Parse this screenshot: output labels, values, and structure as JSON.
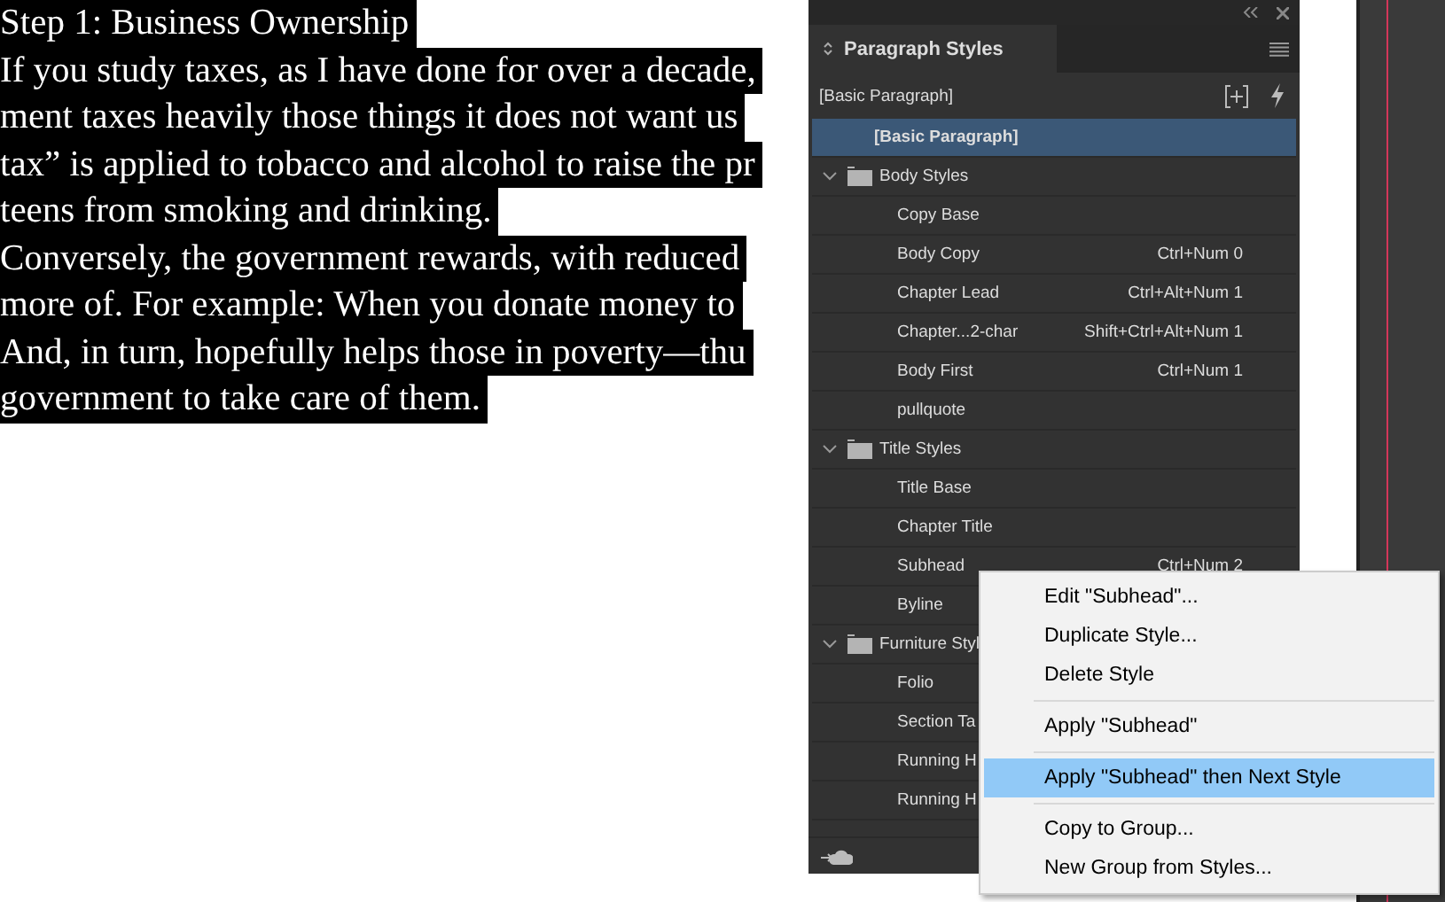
{
  "document": {
    "lines": [
      {
        "text": "Step 1: Business Ownership"
      },
      {
        "text": "If you study taxes, as I have done for over a decade,"
      },
      {
        "text": "ment taxes heavily those things it does not want us"
      },
      {
        "text": "tax” is applied to tobacco and alcohol to raise the pr"
      },
      {
        "text": "teens from smoking and drinking."
      },
      {
        "text": "Conversely, the government rewards, with reduced"
      },
      {
        "text": "more of. For example: When you donate money to"
      },
      {
        "text": "And, in turn, hopefully helps those in poverty—thu"
      },
      {
        "text": "government to take care of them."
      }
    ]
  },
  "panel": {
    "title": "Paragraph Styles",
    "current_style": "[Basic Paragraph]",
    "styles": [
      {
        "kind": "style",
        "name": "[Basic Paragraph]",
        "bold": true,
        "selected": true
      },
      {
        "kind": "group",
        "name": "Body Styles",
        "expanded": true,
        "selected": false,
        "children": [
          {
            "kind": "style",
            "name": "Copy Base",
            "selected": false
          },
          {
            "kind": "style",
            "name": "Body Copy",
            "shortcut": "Ctrl+Num 0",
            "selected": false
          },
          {
            "kind": "style",
            "name": "Chapter Lead",
            "shortcut": "Ctrl+Alt+Num 1",
            "selected": false
          },
          {
            "kind": "style",
            "name": "Chapter...2-char",
            "shortcut": "Shift+Ctrl+Alt+Num 1",
            "selected": false
          },
          {
            "kind": "style",
            "name": "Body First",
            "shortcut": "Ctrl+Num 1",
            "selected": false
          },
          {
            "kind": "style",
            "name": "pullquote",
            "selected": false
          }
        ]
      },
      {
        "kind": "group",
        "name": "Title Styles",
        "expanded": true,
        "selected": false,
        "children": [
          {
            "kind": "style",
            "name": "Title Base",
            "selected": false
          },
          {
            "kind": "style",
            "name": "Chapter Title",
            "selected": false
          },
          {
            "kind": "style",
            "name": "Subhead",
            "shortcut": "Ctrl+Num 2",
            "selected": false
          },
          {
            "kind": "style",
            "name": "Byline",
            "selected": false
          }
        ]
      },
      {
        "kind": "group",
        "name": "Furniture Styl",
        "expanded": true,
        "selected": false,
        "children": [
          {
            "kind": "style",
            "name": "Folio",
            "selected": false
          },
          {
            "kind": "style",
            "name": "Section Ta",
            "selected": false
          },
          {
            "kind": "style",
            "name": "Running H",
            "selected": false
          },
          {
            "kind": "style",
            "name": "Running H",
            "selected": false
          }
        ]
      }
    ]
  },
  "context_menu": {
    "sections": [
      [
        {
          "label": "Edit \"Subhead\"...",
          "selected": false
        },
        {
          "label": "Duplicate Style...",
          "selected": false
        },
        {
          "label": "Delete Style",
          "selected": false
        }
      ],
      [
        {
          "label": "Apply \"Subhead\"",
          "selected": false
        }
      ],
      [
        {
          "label": "Apply \"Subhead\" then Next Style",
          "selected": true
        }
      ],
      [
        {
          "label": "Copy to Group...",
          "selected": false
        },
        {
          "label": "New Group from Styles...",
          "selected": false
        }
      ]
    ]
  }
}
